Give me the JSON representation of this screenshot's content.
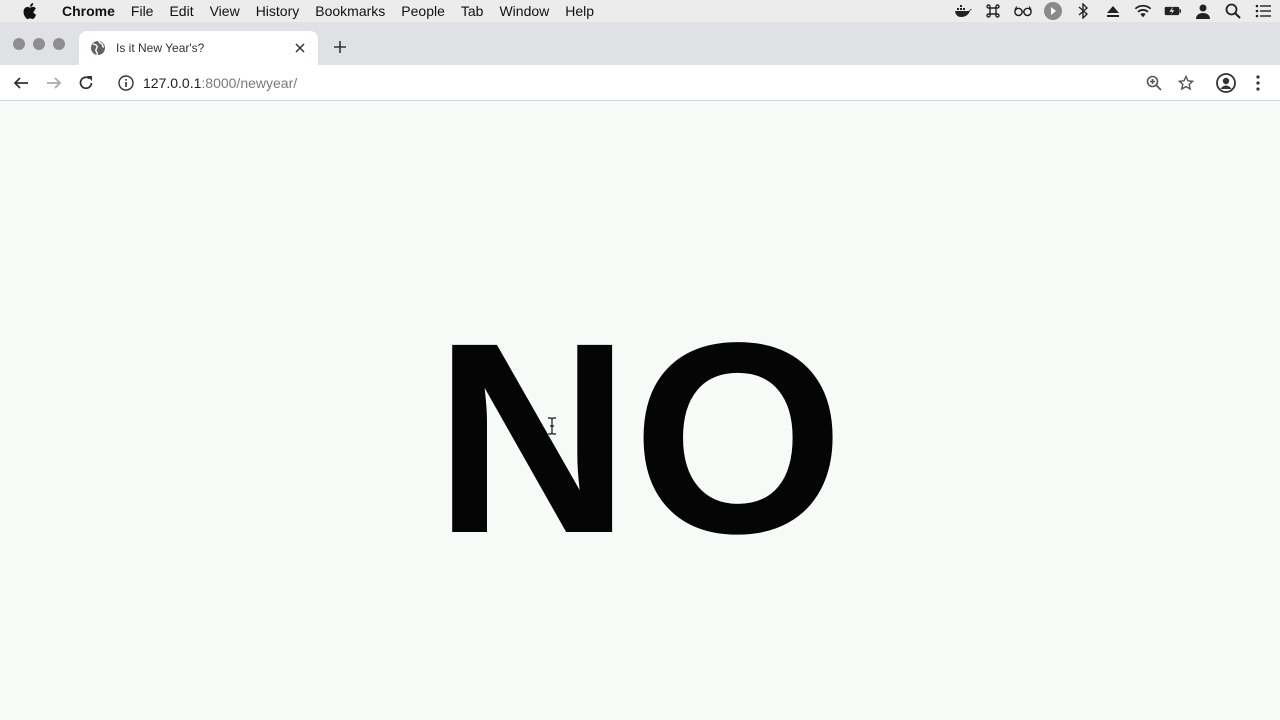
{
  "menubar": {
    "items": [
      "Chrome",
      "File",
      "Edit",
      "View",
      "History",
      "Bookmarks",
      "People",
      "Tab",
      "Window",
      "Help"
    ]
  },
  "tab": {
    "title": "Is it New Year's?"
  },
  "toolbar": {
    "url_host": "127.0.0.1",
    "url_path": ":8000/newyear/"
  },
  "page": {
    "answer": "NO"
  }
}
